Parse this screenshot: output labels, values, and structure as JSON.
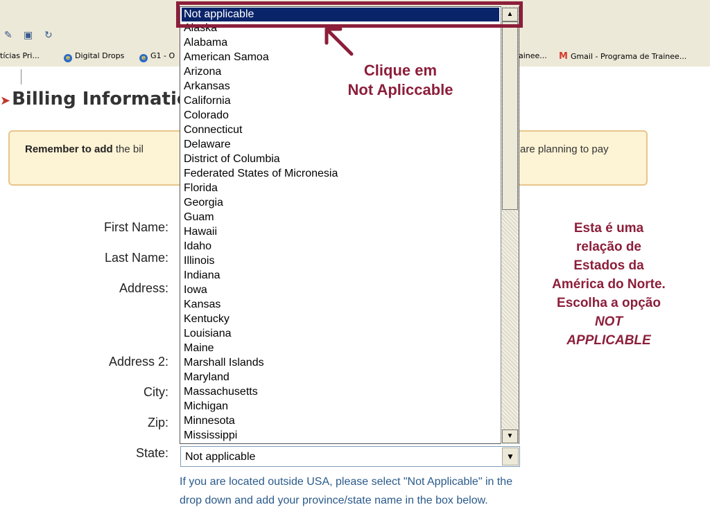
{
  "browser": {
    "links": [
      {
        "label": "tícias  Pri...",
        "icon": "none"
      },
      {
        "label": "Digital Drops",
        "icon": "ie-icon"
      },
      {
        "label": "G1 - O",
        "icon": "ie-icon"
      },
      {
        "label": "ainee...",
        "icon": "none"
      },
      {
        "label": "Gmail - Programa de Trainee...",
        "icon": "gmail-icon"
      }
    ]
  },
  "page": {
    "title": "Billing Informatio",
    "notice": {
      "bold": "Remember to add",
      "text_left": " the bil",
      "text_right": "are planning to pay"
    },
    "form": {
      "first_name_label": "First Name:",
      "last_name_label": "Last Name:",
      "address_label": "Address:",
      "address2_label": "Address 2:",
      "city_label": "City:",
      "zip_label": "Zip:",
      "state_label": "State:",
      "state_value": "Not applicable",
      "help": "If you are located outside USA, please select \"Not Applicable\" in the drop down and add your province/state name in the box below."
    }
  },
  "dropdown": {
    "selected": "Not applicable",
    "options": [
      "Alaska",
      "Alabama",
      "American Samoa",
      "Arizona",
      "Arkansas",
      "California",
      "Colorado",
      "Connecticut",
      "Delaware",
      "District of Columbia",
      "Federated States of Micronesia",
      "Florida",
      "Georgia",
      "Guam",
      "Hawaii",
      "Idaho",
      "Illinois",
      "Indiana",
      "Iowa",
      "Kansas",
      "Kentucky",
      "Louisiana",
      "Maine",
      "Marshall Islands",
      "Maryland",
      "Massachusetts",
      "Michigan",
      "Minnesota",
      "Mississippi"
    ]
  },
  "annotation": {
    "click_line1": "Clique em",
    "click_line2": "Not Apliccable",
    "side_lines": [
      "Esta é uma",
      "relação de",
      "Estados da",
      "América do Norte.",
      "Escolha a opção"
    ],
    "side_em1": "NOT",
    "side_em2": "APPLICABLE",
    "color": "#8c1e3a"
  }
}
